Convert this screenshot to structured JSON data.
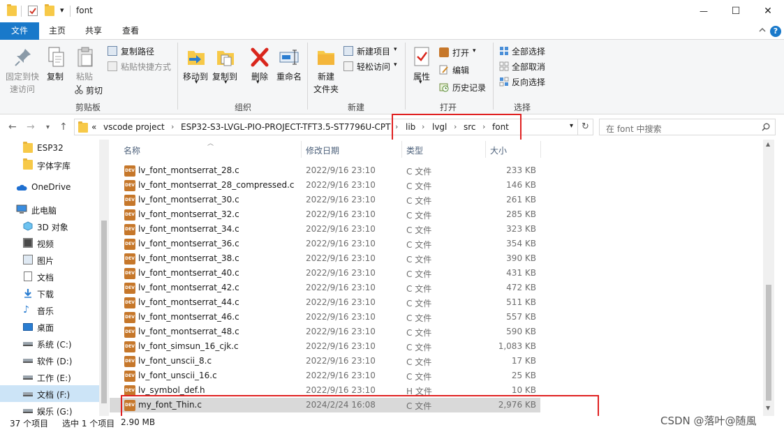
{
  "window": {
    "title": "font",
    "quick_access_dropdown": "▾",
    "minimize": "—",
    "maximize": "☐",
    "close": "✕"
  },
  "tabs": [
    "文件",
    "主页",
    "共享",
    "查看"
  ],
  "ribbon": {
    "clipboard": {
      "pin_line1": "固定到快",
      "pin_line2": "速访问",
      "copy": "复制",
      "paste": "粘贴",
      "copy_path": "复制路径",
      "paste_shortcut": "粘贴快捷方式",
      "cut": "剪切",
      "group": "剪贴板"
    },
    "organize": {
      "move_to": "移动到",
      "copy_to": "复制到",
      "delete": "删除",
      "rename": "重命名",
      "group": "组织"
    },
    "new": {
      "new_folder_line1": "新建",
      "new_folder_line2": "文件夹",
      "new_item": "新建项目",
      "easy_access": "轻松访问",
      "group": "新建"
    },
    "open": {
      "properties": "属性",
      "open": "打开",
      "edit": "编辑",
      "history": "历史记录",
      "group": "打开"
    },
    "select": {
      "select_all": "全部选择",
      "select_none": "全部取消",
      "invert": "反向选择",
      "group": "选择"
    }
  },
  "address": {
    "overflow": "«",
    "crumbs": [
      "vscode project",
      "ESP32-S3-LVGL-PIO-PROJECT-TFT3.5-ST7796U-CPT",
      "lib",
      "lvgl",
      "src",
      "font"
    ],
    "search_placeholder": "在 font 中搜索"
  },
  "sidebar": [
    {
      "label": "ESP32",
      "icon": "folder-icon"
    },
    {
      "label": "字体字库",
      "icon": "folder-icon"
    },
    {
      "label": "OneDrive",
      "icon": "cloud-icon"
    },
    {
      "label": "此电脑",
      "icon": "computer-icon"
    },
    {
      "label": "3D 对象",
      "icon": "cube-icon"
    },
    {
      "label": "视频",
      "icon": "video-icon"
    },
    {
      "label": "图片",
      "icon": "picture-icon"
    },
    {
      "label": "文档",
      "icon": "document-icon"
    },
    {
      "label": "下载",
      "icon": "download-icon"
    },
    {
      "label": "音乐",
      "icon": "music-icon"
    },
    {
      "label": "桌面",
      "icon": "desktop-icon"
    },
    {
      "label": "系统 (C:)",
      "icon": "drive-icon"
    },
    {
      "label": "软件 (D:)",
      "icon": "drive-icon"
    },
    {
      "label": "工作 (E:)",
      "icon": "drive-icon"
    },
    {
      "label": "文档 (F:)",
      "icon": "drive-icon"
    },
    {
      "label": "娱乐 (G:)",
      "icon": "drive-icon"
    }
  ],
  "columns": [
    "名称",
    "修改日期",
    "类型",
    "大小"
  ],
  "files": [
    {
      "name": "lv_font_montserrat_28.c",
      "date": "2022/9/16 23:10",
      "type": "C 文件",
      "size": "233 KB"
    },
    {
      "name": "lv_font_montserrat_28_compressed.c",
      "date": "2022/9/16 23:10",
      "type": "C 文件",
      "size": "146 KB"
    },
    {
      "name": "lv_font_montserrat_30.c",
      "date": "2022/9/16 23:10",
      "type": "C 文件",
      "size": "261 KB"
    },
    {
      "name": "lv_font_montserrat_32.c",
      "date": "2022/9/16 23:10",
      "type": "C 文件",
      "size": "285 KB"
    },
    {
      "name": "lv_font_montserrat_34.c",
      "date": "2022/9/16 23:10",
      "type": "C 文件",
      "size": "323 KB"
    },
    {
      "name": "lv_font_montserrat_36.c",
      "date": "2022/9/16 23:10",
      "type": "C 文件",
      "size": "354 KB"
    },
    {
      "name": "lv_font_montserrat_38.c",
      "date": "2022/9/16 23:10",
      "type": "C 文件",
      "size": "390 KB"
    },
    {
      "name": "lv_font_montserrat_40.c",
      "date": "2022/9/16 23:10",
      "type": "C 文件",
      "size": "431 KB"
    },
    {
      "name": "lv_font_montserrat_42.c",
      "date": "2022/9/16 23:10",
      "type": "C 文件",
      "size": "472 KB"
    },
    {
      "name": "lv_font_montserrat_44.c",
      "date": "2022/9/16 23:10",
      "type": "C 文件",
      "size": "511 KB"
    },
    {
      "name": "lv_font_montserrat_46.c",
      "date": "2022/9/16 23:10",
      "type": "C 文件",
      "size": "557 KB"
    },
    {
      "name": "lv_font_montserrat_48.c",
      "date": "2022/9/16 23:10",
      "type": "C 文件",
      "size": "590 KB"
    },
    {
      "name": "lv_font_simsun_16_cjk.c",
      "date": "2022/9/16 23:10",
      "type": "C 文件",
      "size": "1,083 KB"
    },
    {
      "name": "lv_font_unscii_8.c",
      "date": "2022/9/16 23:10",
      "type": "C 文件",
      "size": "17 KB"
    },
    {
      "name": "lv_font_unscii_16.c",
      "date": "2022/9/16 23:10",
      "type": "C 文件",
      "size": "25 KB"
    },
    {
      "name": "lv_symbol_def.h",
      "date": "2022/9/16 23:10",
      "type": "H 文件",
      "size": "10 KB"
    },
    {
      "name": "my_font_Thin.c",
      "date": "2024/2/24 16:08",
      "type": "C 文件",
      "size": "2,976 KB"
    }
  ],
  "status": {
    "count": "37 个项目",
    "selected": "选中 1 个项目",
    "size": "2.90 MB"
  },
  "watermark": "CSDN @落叶@随風"
}
